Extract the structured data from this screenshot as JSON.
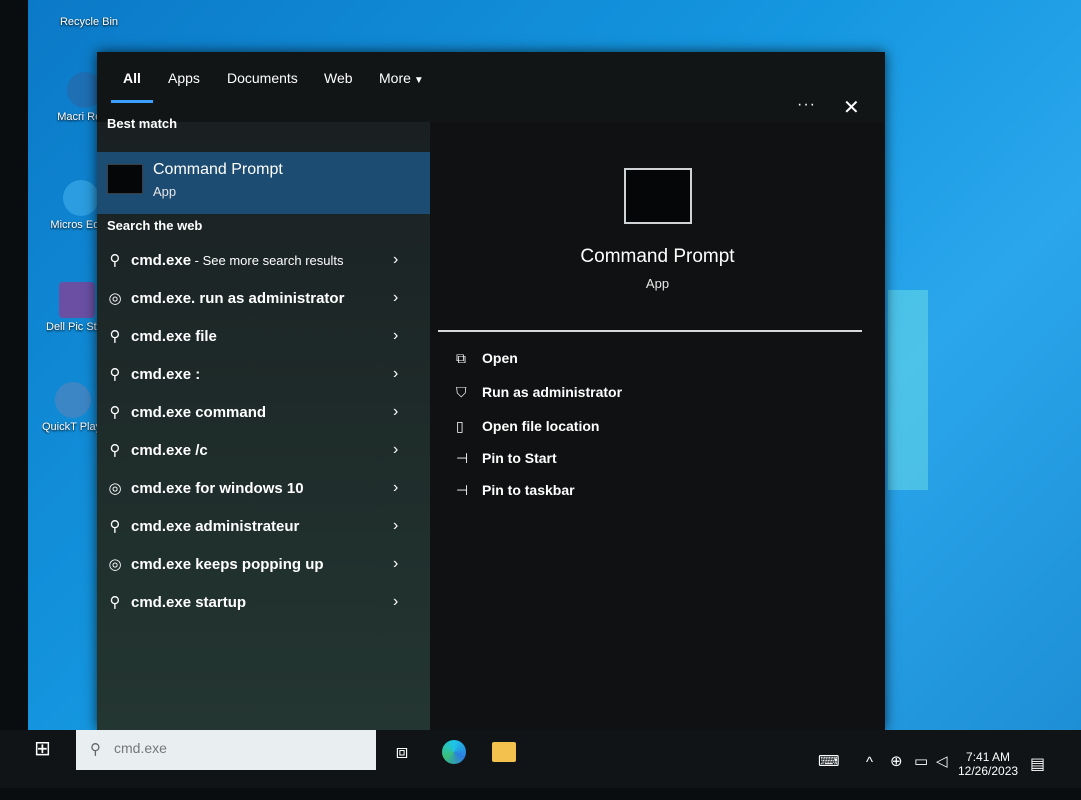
{
  "desktop": {
    "icons": [
      {
        "label": "Recycle Bin",
        "color": "#cfd8dc"
      },
      {
        "label": "Macri Refle",
        "color": "#1f6fb5"
      },
      {
        "label": "Micros Edge",
        "color": "#2b9de0"
      },
      {
        "label": "Dell Pic Studi",
        "color": "#6a4fa3"
      },
      {
        "label": "QuickT Playe",
        "color": "#3d86c6"
      }
    ]
  },
  "search": {
    "tabs": [
      {
        "label": "All",
        "active": true
      },
      {
        "label": "Apps"
      },
      {
        "label": "Documents"
      },
      {
        "label": "Web"
      },
      {
        "label": "More"
      }
    ],
    "more_icon": "caret-down-icon",
    "options_icon": "ellipsis-icon",
    "close_icon": "close-icon",
    "best_match_header": "Best match",
    "best_match": {
      "title": "Command Prompt",
      "subtitle": "App"
    },
    "web_header": "Search the web",
    "web_results": [
      {
        "text": "cmd.exe",
        "suffix": " - See more search results",
        "icon": "search-icon"
      },
      {
        "text": "cmd.exe. run as administrator",
        "icon": "web-history-icon"
      },
      {
        "text": "cmd.exe file",
        "icon": "search-icon"
      },
      {
        "text": "cmd.exe :",
        "icon": "search-icon"
      },
      {
        "text": "cmd.exe command",
        "icon": "search-icon"
      },
      {
        "text": "cmd.exe /c",
        "icon": "search-icon"
      },
      {
        "text": "cmd.exe for windows 10",
        "icon": "web-history-icon"
      },
      {
        "text": "cmd.exe administrateur",
        "icon": "search-icon"
      },
      {
        "text": "cmd.exe keeps popping up",
        "icon": "web-history-icon"
      },
      {
        "text": "cmd.exe startup",
        "icon": "search-icon"
      }
    ],
    "preview": {
      "title": "Command Prompt",
      "subtitle": "App",
      "actions": [
        {
          "label": "Open",
          "icon": "open-icon"
        },
        {
          "label": "Run as administrator",
          "icon": "shield-icon"
        },
        {
          "label": "Open file location",
          "icon": "file-location-icon"
        },
        {
          "label": "Pin to Start",
          "icon": "pin-icon"
        },
        {
          "label": "Pin to taskbar",
          "icon": "pin-icon"
        }
      ]
    }
  },
  "taskbar": {
    "search_value": "cmd.exe",
    "clock_time": "7:41 AM",
    "clock_date": "12/26/2023",
    "accent": "#1d4c73"
  }
}
